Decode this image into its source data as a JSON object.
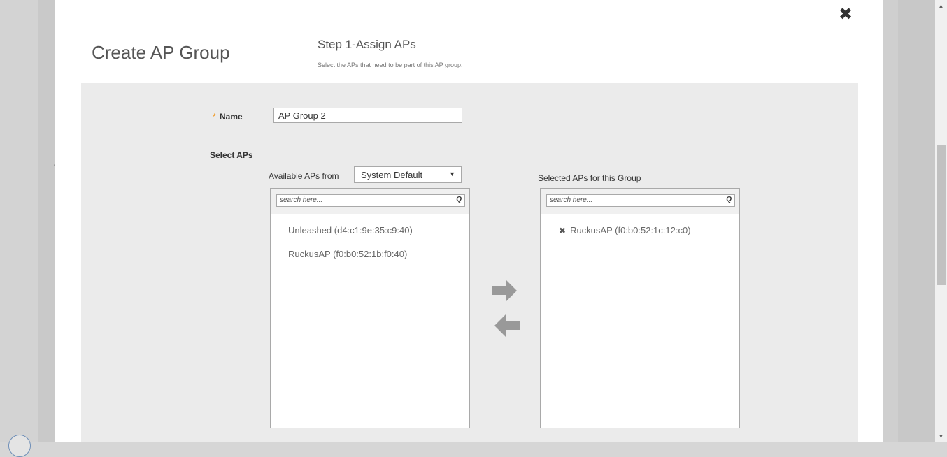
{
  "modal": {
    "title": "Create AP Group",
    "close_icon": "close-icon",
    "step": {
      "title": "Step 1-Assign APs",
      "subtitle": "Select the APs that need to be part of this AP group."
    }
  },
  "form": {
    "name_required_marker": "*",
    "name_label": "Name",
    "name_value": "AP Group 2",
    "select_aps_label": "Select APs",
    "available_label": "Available APs from",
    "group_select_value": "System Default",
    "selected_label": "Selected APs for this Group"
  },
  "available_list": {
    "search_placeholder": "search here...",
    "items": [
      "Unleashed (d4:c1:9e:35:c9:40)",
      "RuckusAP (f0:b0:52:1b:f0:40)"
    ]
  },
  "selected_list": {
    "search_placeholder": "search here...",
    "items": [
      "RuckusAP (f0:b0:52:1c:12:c0)"
    ]
  },
  "icons": {
    "close": "✖",
    "search": "Q",
    "remove": "✖",
    "dropdown": "▼",
    "scroll_up": "▲",
    "scroll_down": "▼"
  },
  "colors": {
    "required_marker": "#f28b00",
    "arrow_buttons": "#999999",
    "content_background": "#ebebeb"
  }
}
